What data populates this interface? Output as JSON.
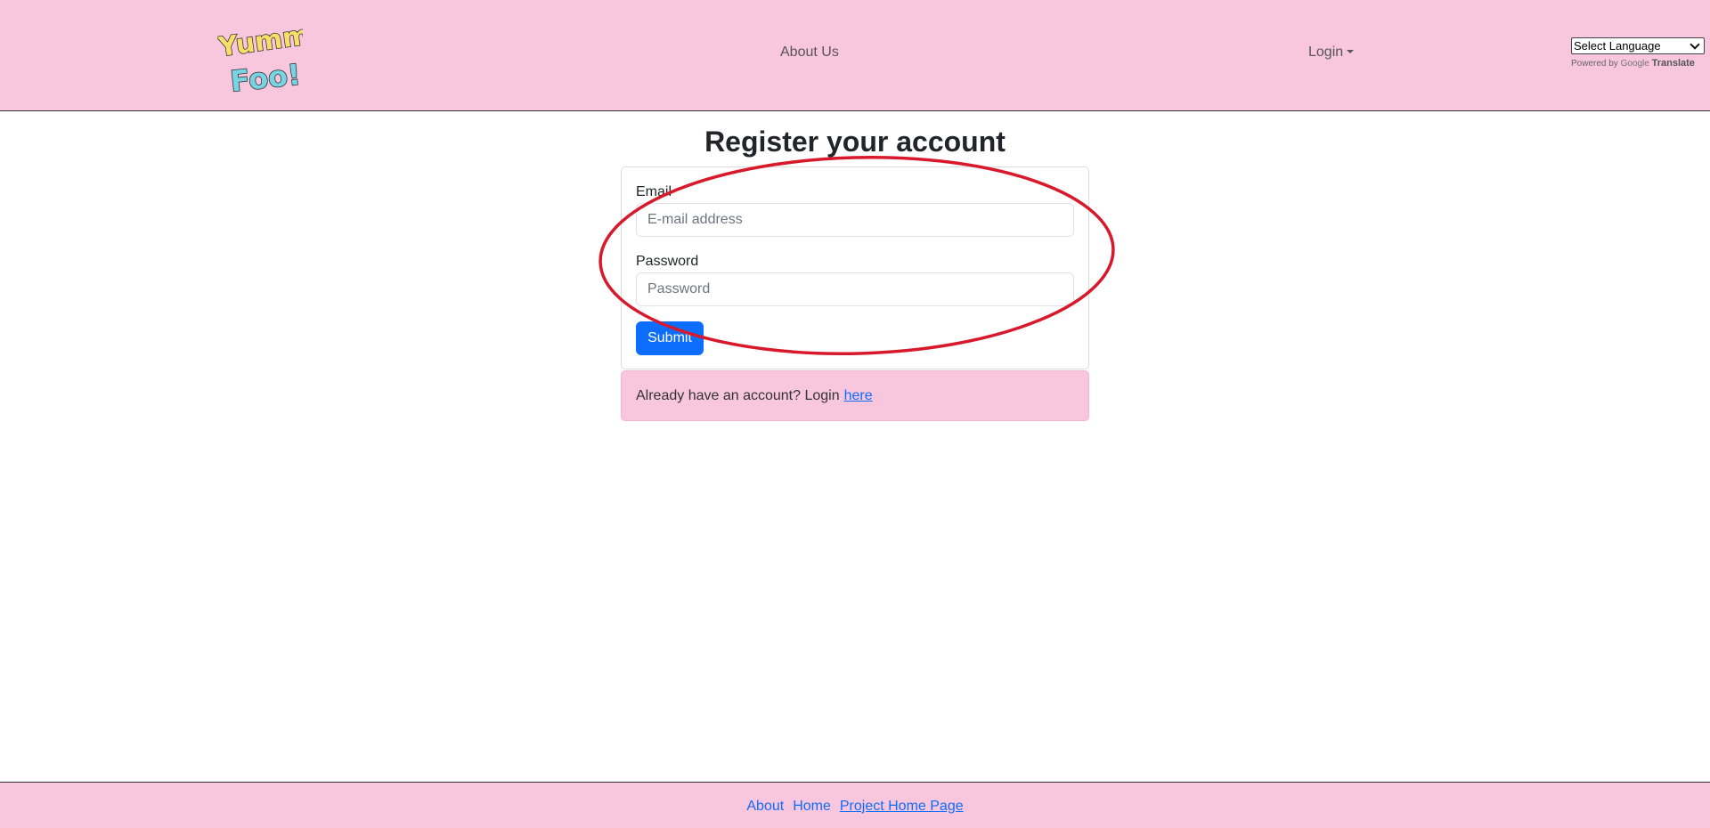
{
  "header": {
    "logo_text_line1": "Yummy",
    "logo_text_line2": "Foo!",
    "nav": {
      "about_label": "About Us",
      "login_label": "Login"
    },
    "translate": {
      "select_label": "Select Language",
      "powered_by": "Powered by",
      "google": "Google",
      "translate_label": "Translate"
    }
  },
  "main": {
    "title": "Register your account",
    "form": {
      "email_label": "Email",
      "email_placeholder": "E-mail address",
      "password_label": "Password",
      "password_placeholder": "Password",
      "submit_label": "Submit"
    },
    "login_prompt": {
      "text": "Already have an account? Login",
      "link_label": "here"
    },
    "annotation_color": "#d7192b"
  },
  "footer": {
    "links": [
      "About",
      "Home",
      "Project Home Page"
    ]
  },
  "colors": {
    "header_bg": "#f8c6dd",
    "primary": "#0d6efd"
  }
}
